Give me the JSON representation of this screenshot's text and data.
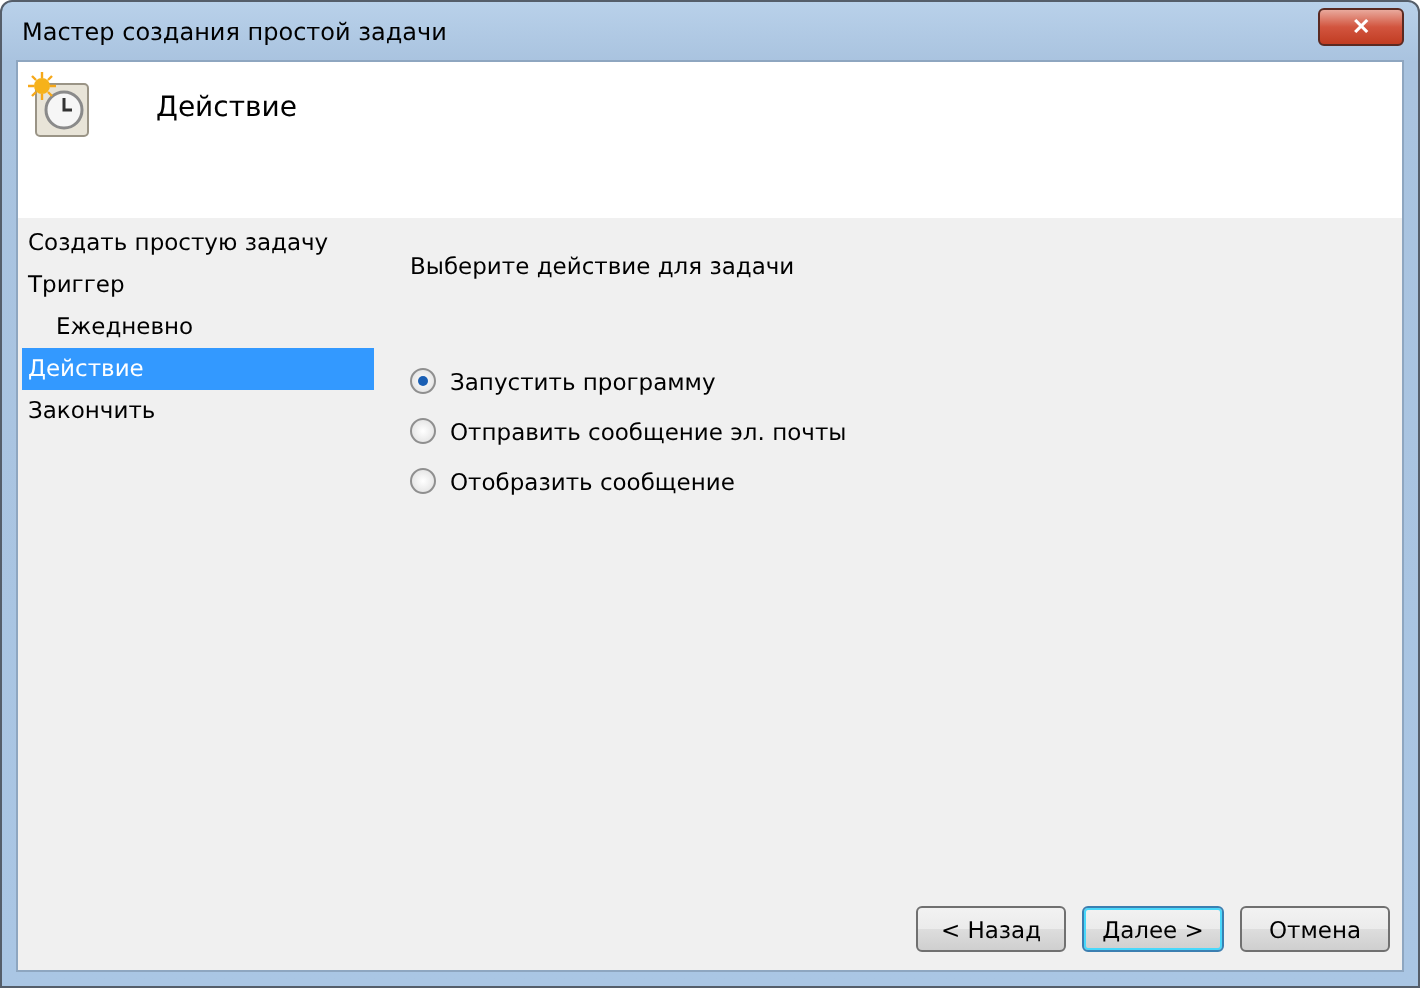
{
  "window": {
    "title": "Мастер создания простой задачи",
    "close_label": "✕"
  },
  "header": {
    "title": "Действие"
  },
  "sidebar": {
    "items": [
      {
        "label": "Создать простую задачу",
        "selected": false
      },
      {
        "label": "Триггер",
        "selected": false,
        "children": [
          {
            "label": "Ежедневно",
            "selected": false
          }
        ]
      },
      {
        "label": "Действие",
        "selected": true
      },
      {
        "label": "Закончить",
        "selected": false
      }
    ]
  },
  "main": {
    "prompt": "Выберите действие для задачи",
    "options": [
      {
        "label": "Запустить программу",
        "selected": true
      },
      {
        "label": "Отправить сообщение эл. почты",
        "selected": false
      },
      {
        "label": "Отобразить сообщение",
        "selected": false
      }
    ]
  },
  "buttons": [
    {
      "label": "< Назад",
      "default": false
    },
    {
      "label": "Далее >",
      "default": true
    },
    {
      "label": "Отмена",
      "default": false
    }
  ]
}
